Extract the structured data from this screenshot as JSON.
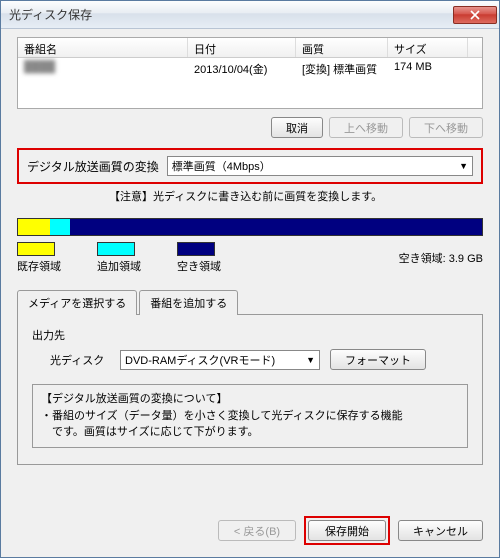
{
  "window": {
    "title": "光ディスク保存"
  },
  "table": {
    "headers": {
      "name": "番組名",
      "date": "日付",
      "quality": "画質",
      "size": "サイズ"
    },
    "row": {
      "name": "████",
      "date": "2013/10/04(金)",
      "quality": "[変換] 標準画質",
      "size": "174 MB"
    }
  },
  "buttons": {
    "cancel": "取消",
    "move_up": "上へ移動",
    "move_down": "下へ移動"
  },
  "conversion": {
    "label": "デジタル放送画質の変換",
    "selected": "標準画質（4Mbps）",
    "note": "【注意】光ディスクに書き込む前に画質を変換します。"
  },
  "legend": {
    "used": "既存領域",
    "add": "追加領域",
    "free": "空き領域"
  },
  "free_space": {
    "label": "空き領域:",
    "value": "3.9 GB"
  },
  "tabs": {
    "select_media": "メディアを選択する",
    "add_program": "番組を追加する"
  },
  "output": {
    "section": "出力先",
    "disc_label": "光ディスク",
    "disc_selected": "DVD-RAMディスク(VRモード)",
    "format_btn": "フォーマット"
  },
  "info": {
    "title": "【デジタル放送画質の変換について】",
    "line1": "・番組のサイズ（データ量）を小さく変換して光ディスクに保存する機能",
    "line2": "　です。画質はサイズに応じて下がります。"
  },
  "footer": {
    "back": "< 戻る(B)",
    "save": "保存開始",
    "cancel": "キャンセル"
  }
}
